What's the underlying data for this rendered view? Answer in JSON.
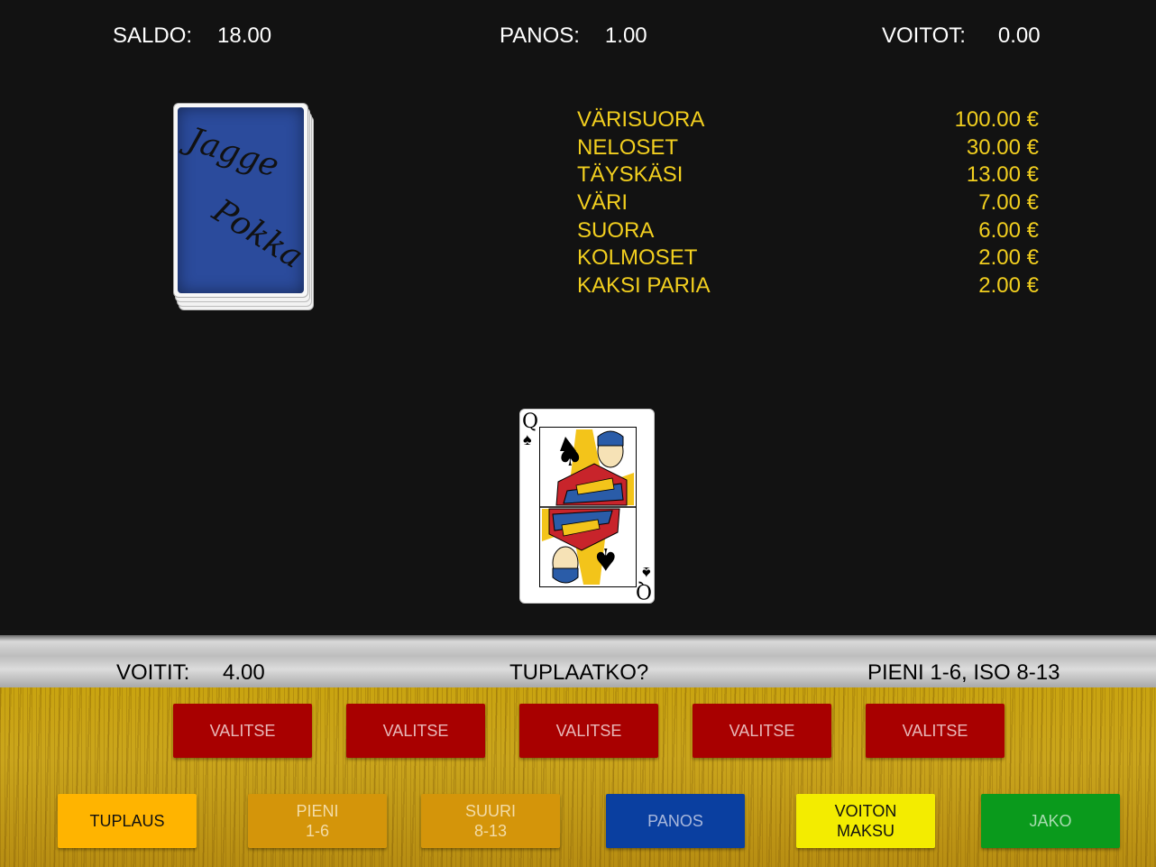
{
  "header": {
    "saldo_label": "SALDO:",
    "saldo_value": "18.00",
    "panos_label": "PANOS:",
    "panos_value": "1.00",
    "voitot_label": "VOITOT:",
    "voitot_value": "0.00"
  },
  "deck": {
    "script_line1": "Jagge",
    "script_line2": "Pokka"
  },
  "paytable": [
    {
      "hand": "VÄRISUORA",
      "payout": "100.00 €"
    },
    {
      "hand": "NELOSET",
      "payout": "30.00 €"
    },
    {
      "hand": "TÄYSKÄSI",
      "payout": "13.00 €"
    },
    {
      "hand": "VÄRI",
      "payout": "7.00 €"
    },
    {
      "hand": "SUORA",
      "payout": "6.00 €"
    },
    {
      "hand": "KOLMOSET",
      "payout": "2.00 €"
    },
    {
      "hand": "KAKSI PARIA",
      "payout": "2.00 €"
    }
  ],
  "card": {
    "rank": "Q",
    "suit_symbol": "♠",
    "suit_name": "spades"
  },
  "status_bar": {
    "voitit_label": "VOITIT:",
    "voitit_value": "4.00",
    "prompt": "TUPLAATKO?",
    "hint": "PIENI 1-6, ISO 8-13"
  },
  "select_buttons": [
    "VALITSE",
    "VALITSE",
    "VALITSE",
    "VALITSE",
    "VALITSE"
  ],
  "action_buttons": {
    "tuplaus": "TUPLAUS",
    "pieni_line1": "PIENI",
    "pieni_line2": "1-6",
    "suuri_line1": "SUURI",
    "suuri_line2": "8-13",
    "panos": "PANOS",
    "voiton_line1": "VOITON",
    "voiton_line2": "MAKSU",
    "jako": "JAKO"
  },
  "colors": {
    "background": "#121212",
    "paytable_text": "#f2cf1f",
    "select_button": "#a80000",
    "tuplaus_button": "#ffb400",
    "pieni_suuri_button": "#d4950a",
    "panos_button": "#0a3fa0",
    "voiton_maksu_button": "#f3ec00",
    "jako_button": "#0a9a1c"
  }
}
